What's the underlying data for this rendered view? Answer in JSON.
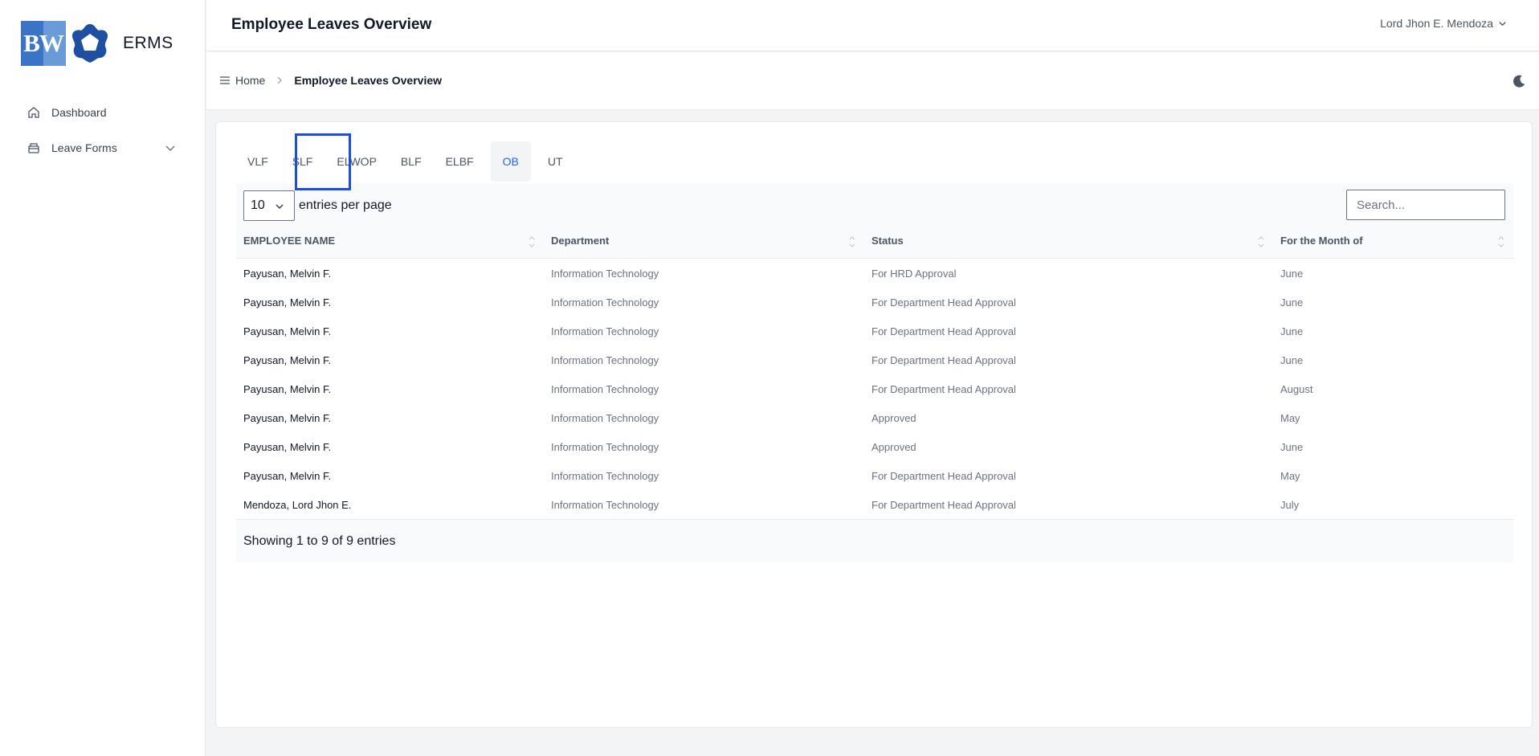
{
  "app": {
    "logo_text": "ERMS",
    "logo_mark": "BW"
  },
  "sidebar": {
    "items": [
      {
        "label": "Dashboard",
        "icon": "home-icon"
      },
      {
        "label": "Leave Forms",
        "icon": "inbox-icon"
      }
    ]
  },
  "header": {
    "title": "Employee Leaves Overview",
    "user": "Lord Jhon E. Mendoza"
  },
  "breadcrumb": {
    "home": "Home",
    "current": "Employee Leaves Overview"
  },
  "tabs": [
    {
      "label": "VLF"
    },
    {
      "label": "SLF"
    },
    {
      "label": "ELWOP"
    },
    {
      "label": "BLF"
    },
    {
      "label": "ELBF"
    },
    {
      "label": "OB",
      "active": true
    },
    {
      "label": "UT"
    }
  ],
  "table": {
    "per_page_value": "10",
    "per_page_label": "entries per page",
    "search_placeholder": "Search...",
    "columns": [
      "EMPLOYEE NAME",
      "Department",
      "Status",
      "For the Month of"
    ],
    "rows": [
      [
        "Payusan, Melvin F.",
        "Information Technology",
        "For HRD Approval",
        "June"
      ],
      [
        "Payusan, Melvin F.",
        "Information Technology",
        "For Department Head Approval",
        "June"
      ],
      [
        "Payusan, Melvin F.",
        "Information Technology",
        "For Department Head Approval",
        "June"
      ],
      [
        "Payusan, Melvin F.",
        "Information Technology",
        "For Department Head Approval",
        "June"
      ],
      [
        "Payusan, Melvin F.",
        "Information Technology",
        "For Department Head Approval",
        "August"
      ],
      [
        "Payusan, Melvin F.",
        "Information Technology",
        "Approved",
        "May"
      ],
      [
        "Payusan, Melvin F.",
        "Information Technology",
        "Approved",
        "June"
      ],
      [
        "Payusan, Melvin F.",
        "Information Technology",
        "For Department Head Approval",
        "May"
      ],
      [
        "Mendoza, Lord Jhon E.",
        "Information Technology",
        "For Department Head Approval",
        "July"
      ]
    ],
    "footer": "Showing 1 to 9 of 9 entries"
  },
  "colors": {
    "accent": "#2563eb",
    "highlight": "#1d4ed8",
    "logo": "#3b73c6"
  }
}
